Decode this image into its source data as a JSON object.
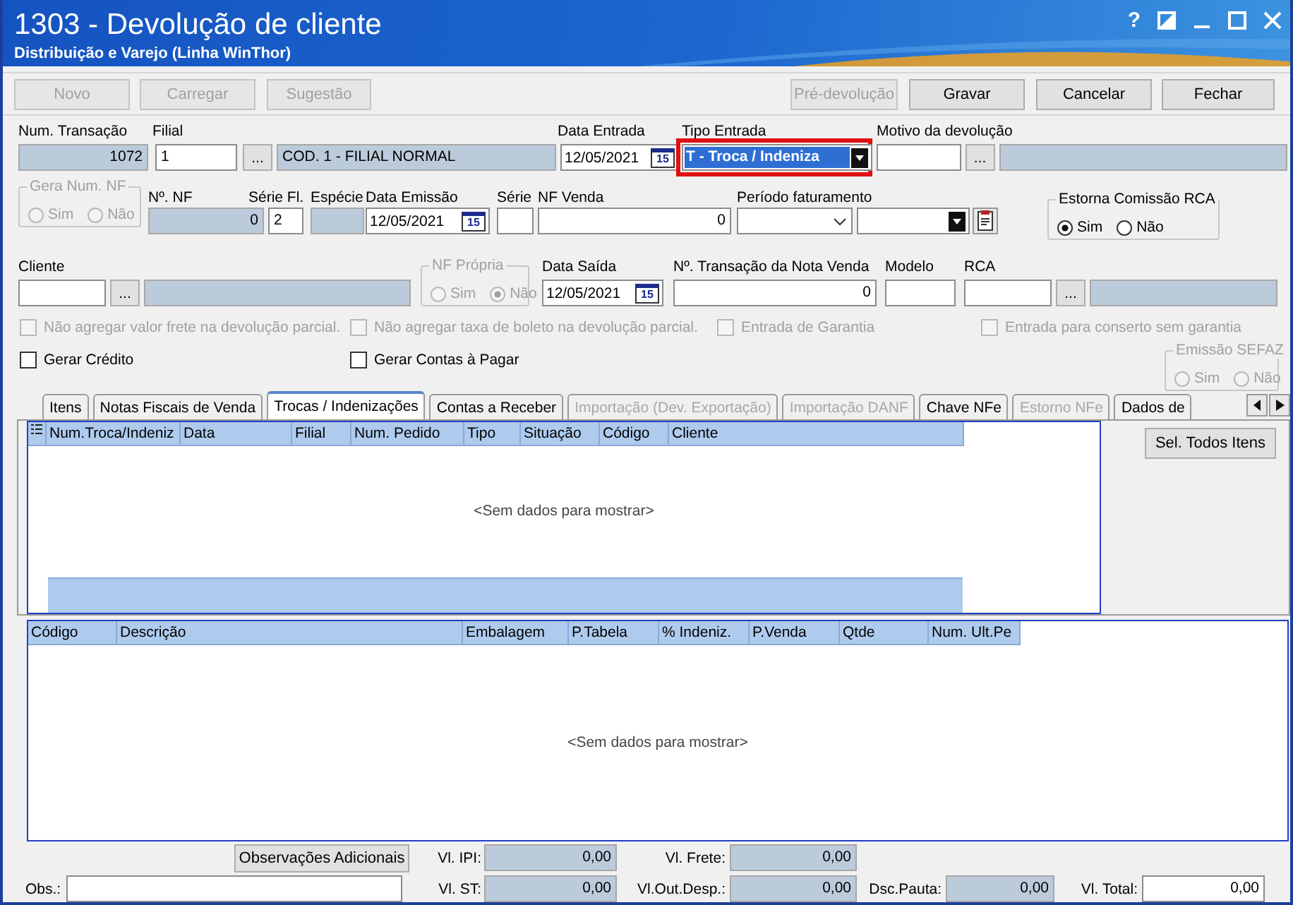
{
  "window": {
    "title": "1303 - Devolução de cliente",
    "subtitle": "Distribuição e Varejo (Linha WinThor)",
    "help": "?"
  },
  "toolbar": [
    {
      "label": "Novo",
      "disabled": true
    },
    {
      "label": "Carregar",
      "disabled": true
    },
    {
      "label": "Sugestão",
      "disabled": true
    },
    {
      "label": "Pré-devolução",
      "disabled": true
    },
    {
      "label": "Gravar",
      "disabled": false
    },
    {
      "label": "Cancelar",
      "disabled": false
    },
    {
      "label": "Fechar",
      "disabled": false
    }
  ],
  "form": {
    "num_transacao": {
      "label": "Num. Transação",
      "value": "1072"
    },
    "filial": {
      "label": "Filial",
      "value": "1",
      "lookup": "...",
      "description": "COD. 1 - FILIAL NORMAL"
    },
    "data_entrada": {
      "label": "Data Entrada",
      "value": "12/05/2021",
      "calendar": "15"
    },
    "tipo_entrada": {
      "label": "Tipo Entrada",
      "value": "T - Troca / Indeniza",
      "highlighted": true
    },
    "motivo_devolucao": {
      "label": "Motivo da devolução",
      "lookup": "..."
    },
    "gera_num_nf": {
      "label": "Gera Num. NF",
      "disabled": true,
      "options": [
        {
          "label": "Sim",
          "selected": false
        },
        {
          "label": "Não",
          "selected": false
        }
      ]
    },
    "num_nf": {
      "label": "Nº. NF",
      "value": "0"
    },
    "serie_fl": {
      "label": "Série Fl.",
      "value": "2"
    },
    "especie": {
      "label": "Espécie"
    },
    "data_emissao": {
      "label": "Data Emissão",
      "value": "12/05/2021",
      "calendar": "15"
    },
    "serie": {
      "label": "Série"
    },
    "nf_venda": {
      "label": "NF Venda",
      "value": "0"
    },
    "periodo_faturamento": {
      "label": "Período faturamento"
    },
    "estorna_comissao_rca": {
      "label": "Estorna Comissão RCA",
      "disabled": false,
      "options": [
        {
          "label": "Sim",
          "selected": true
        },
        {
          "label": "Não",
          "selected": false
        }
      ]
    },
    "cliente": {
      "label": "Cliente",
      "lookup": "..."
    },
    "nf_propria": {
      "label": "NF Própria",
      "disabled": true,
      "options": [
        {
          "label": "Sim",
          "selected": false
        },
        {
          "label": "Não",
          "selected": true
        }
      ]
    },
    "data_saida": {
      "label": "Data Saída",
      "value": "12/05/2021",
      "calendar": "15"
    },
    "num_transacao_nota_venda": {
      "label": "Nº. Transação da Nota Venda",
      "value": "0"
    },
    "modelo": {
      "label": "Modelo"
    },
    "rca": {
      "label": "RCA",
      "lookup": "..."
    },
    "options_row_1": [
      {
        "label": "Não agregar valor frete na devolução parcial.",
        "checked": false,
        "disabled": true
      },
      {
        "label": "Não agregar taxa de boleto na devolução parcial.",
        "checked": false,
        "disabled": true
      },
      {
        "label": "Entrada de Garantia",
        "checked": false,
        "disabled": true
      },
      {
        "label": "Entrada para conserto sem garantia",
        "checked": false,
        "disabled": true
      }
    ],
    "options_row_2": [
      {
        "label": "Gerar Crédito",
        "checked": false,
        "disabled": false
      },
      {
        "label": "Gerar Contas à Pagar",
        "checked": false,
        "disabled": false
      }
    ],
    "emissao_sefaz": {
      "label": "Emissão SEFAZ",
      "disabled": true,
      "options": [
        {
          "label": "Sim",
          "selected": false
        },
        {
          "label": "Não",
          "selected": false
        }
      ]
    }
  },
  "tabs": [
    {
      "label": "Itens",
      "selected": false,
      "disabled": false
    },
    {
      "label": "Notas Fiscais de Venda",
      "selected": false,
      "disabled": false
    },
    {
      "label": "Trocas / Indenizações",
      "selected": true,
      "disabled": false
    },
    {
      "label": "Contas a Receber",
      "selected": false,
      "disabled": false
    },
    {
      "label": "Importação (Dev. Exportação)",
      "selected": false,
      "disabled": true
    },
    {
      "label": "Importação DANF",
      "selected": false,
      "disabled": true
    },
    {
      "label": "Chave NFe",
      "selected": false,
      "disabled": false
    },
    {
      "label": "Estorno NFe",
      "selected": false,
      "disabled": true
    },
    {
      "label": "Dados de",
      "selected": false,
      "disabled": false
    }
  ],
  "trocas_grid": {
    "columns": [
      "Num.Troca/Indeniz",
      "Data",
      "Filial",
      "Num. Pedido",
      "Tipo",
      "Situação",
      "Código",
      "Cliente"
    ],
    "empty_text": "<Sem dados para mostrar>"
  },
  "select_all_button": "Sel. Todos Itens",
  "itens_grid": {
    "columns": [
      "Código",
      "Descrição",
      "Embalagem",
      "P.Tabela",
      "% Indeniz.",
      "P.Venda",
      "Qtde",
      "Num. Ult.Pe"
    ],
    "empty_text": "<Sem dados para mostrar>"
  },
  "footer": {
    "observacoes_button": "Observações Adicionais",
    "obs_label": "Obs.:",
    "totals": [
      {
        "label": "Vl. IPI:",
        "value": "0,00",
        "editable": false
      },
      {
        "label": "Vl. Frete:",
        "value": "0,00",
        "editable": false
      },
      {
        "label": "Vl. ST:",
        "value": "0,00",
        "editable": false
      },
      {
        "label": "Vl.Out.Desp.:",
        "value": "0,00",
        "editable": false
      },
      {
        "label": "Dsc.Pauta:",
        "value": "0,00",
        "editable": false
      },
      {
        "label": "Vl. Total:",
        "value": "0,00",
        "editable": true
      }
    ]
  }
}
